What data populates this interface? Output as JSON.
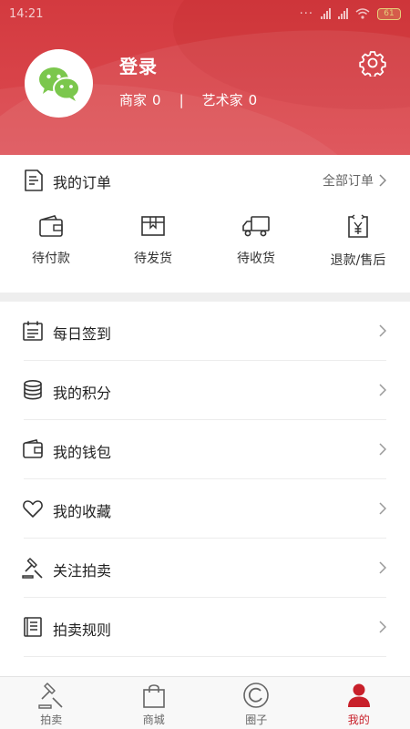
{
  "status_bar": {
    "time": "14:21",
    "battery": "61"
  },
  "profile": {
    "login_label": "登录",
    "merchant_label": "商家",
    "merchant_count": "0",
    "separator": "|",
    "artist_label": "艺术家",
    "artist_count": "0",
    "avatar_icon": "wechat-icon",
    "settings_icon": "gear-icon"
  },
  "orders": {
    "title": "我的订单",
    "all_orders": "全部订单",
    "items": [
      {
        "label": "待付款",
        "icon": "wallet-icon"
      },
      {
        "label": "待发货",
        "icon": "package-icon"
      },
      {
        "label": "待收货",
        "icon": "truck-icon"
      },
      {
        "label": "退款/售后",
        "icon": "refund-icon"
      }
    ]
  },
  "menu": [
    {
      "label": "每日签到",
      "icon": "calendar-icon"
    },
    {
      "label": "我的积分",
      "icon": "coins-icon"
    },
    {
      "label": "我的钱包",
      "icon": "wallet-icon"
    },
    {
      "label": "我的收藏",
      "icon": "heart-icon"
    },
    {
      "label": "关注拍卖",
      "icon": "gavel-icon"
    },
    {
      "label": "拍卖规则",
      "icon": "rules-icon"
    }
  ],
  "bottom_nav": [
    {
      "label": "拍卖",
      "icon": "auction-icon",
      "active": false
    },
    {
      "label": "商城",
      "icon": "shopping-bag-icon",
      "active": false
    },
    {
      "label": "圈子",
      "icon": "circle-icon",
      "active": false
    },
    {
      "label": "我的",
      "icon": "user-icon",
      "active": true
    }
  ],
  "colors": {
    "accent": "#c8202a",
    "header": "#d9444a",
    "wechat": "#7bc74d"
  }
}
